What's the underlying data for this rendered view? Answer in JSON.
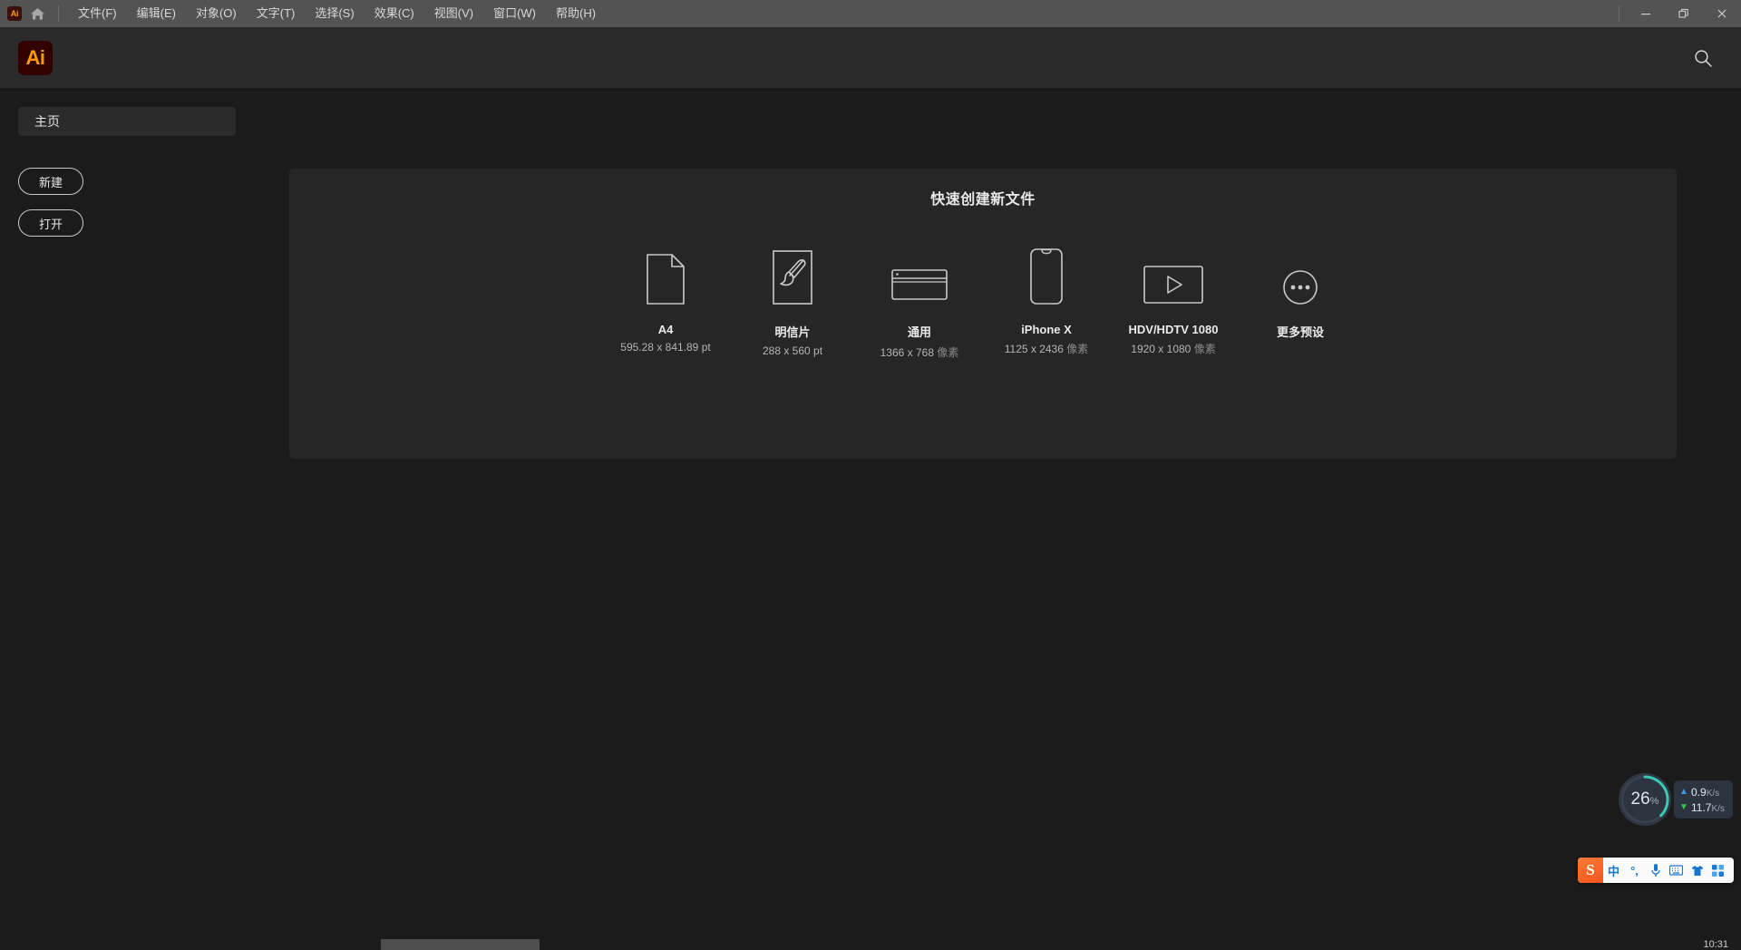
{
  "titlebar": {
    "app_badge": "Ai",
    "home_icon": "home-icon",
    "menus": [
      {
        "label": "文件(F)"
      },
      {
        "label": "编辑(E)"
      },
      {
        "label": "对象(O)"
      },
      {
        "label": "文字(T)"
      },
      {
        "label": "选择(S)"
      },
      {
        "label": "效果(C)"
      },
      {
        "label": "视图(V)"
      },
      {
        "label": "窗口(W)"
      },
      {
        "label": "帮助(H)"
      }
    ],
    "window_controls": {
      "minimize": "minimize-icon",
      "restore": "restore-icon",
      "close": "close-icon"
    }
  },
  "header": {
    "logo_text": "Ai",
    "logo_bg": "#330000",
    "logo_fg": "#ff9a00",
    "search_icon": "search-icon"
  },
  "sidebar": {
    "items": [
      {
        "label": "主页",
        "active": true
      }
    ],
    "buttons": [
      {
        "label": "新建"
      },
      {
        "label": "打开"
      }
    ]
  },
  "main": {
    "panel_title": "快速创建新文件",
    "presets": [
      {
        "icon": "document-page-icon",
        "name": "A4",
        "size": "595.28 x 841.89 pt",
        "unit": ""
      },
      {
        "icon": "paintbrush-icon",
        "name": "明信片",
        "size": "288 x 560 pt",
        "unit": ""
      },
      {
        "icon": "browser-window-icon",
        "name": "通用",
        "size": "1366 x 768",
        "unit": "像素"
      },
      {
        "icon": "phone-icon",
        "name": "iPhone X",
        "size": "1125 x 2436",
        "unit": "像素"
      },
      {
        "icon": "video-play-icon",
        "name": "HDV/HDTV 1080",
        "size": "1920 x 1080",
        "unit": "像素"
      },
      {
        "icon": "more-dots-icon",
        "name": "更多预设",
        "size": "",
        "unit": ""
      }
    ]
  },
  "perf_widget": {
    "cpu_percent": "26",
    "percent_sign": "%",
    "gauge_color": "#39c9b4",
    "upload": {
      "icon": "arrow-up-icon",
      "value": "0.9",
      "unit": "K/s"
    },
    "download": {
      "icon": "arrow-down-icon",
      "value": "11.7",
      "unit": "K/s"
    }
  },
  "ime_bar": {
    "logo": "S",
    "items": [
      {
        "glyph": "中",
        "name": "language-mode-icon"
      },
      {
        "glyph": "°,",
        "name": "punctuation-icon"
      },
      {
        "glyph": "",
        "name": "microphone-icon"
      },
      {
        "glyph": "",
        "name": "keyboard-icon"
      },
      {
        "glyph": "",
        "name": "skin-icon"
      },
      {
        "glyph": "",
        "name": "apps-grid-icon"
      }
    ]
  },
  "taskbar": {
    "clock": "10:31"
  }
}
